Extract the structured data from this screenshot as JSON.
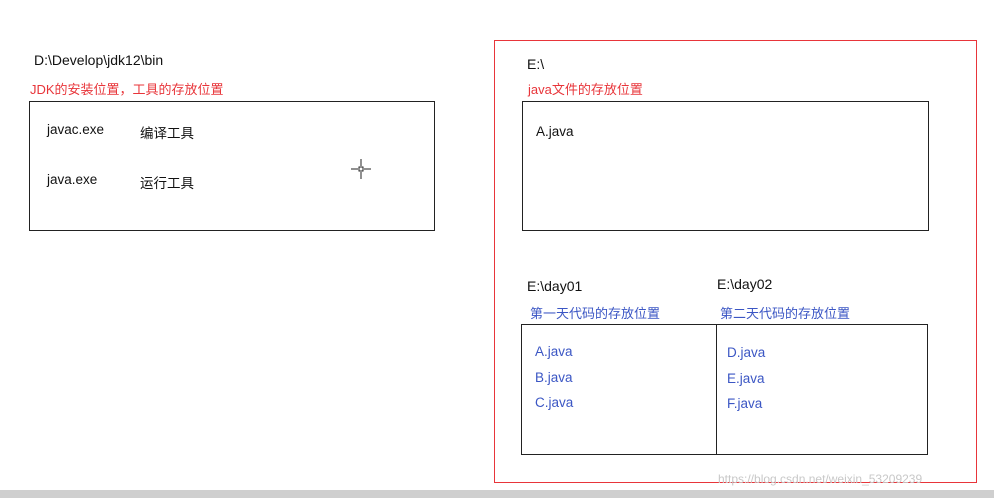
{
  "left": {
    "path": "D:\\Develop\\jdk12\\bin",
    "caption": "JDK的安装位置，工具的存放位置",
    "items": [
      {
        "file": "javac.exe",
        "desc": "编译工具"
      },
      {
        "file": "java.exe",
        "desc": "运行工具"
      }
    ]
  },
  "right": {
    "path": "E:\\",
    "caption": "java文件的存放位置",
    "file": "A.java",
    "day01": {
      "path": "E:\\day01",
      "caption": "第一天代码的存放位置",
      "files": [
        "A.java",
        "B.java",
        "C.java"
      ]
    },
    "day02": {
      "path": "E:\\day02",
      "caption": "第二天代码的存放位置",
      "files": [
        "D.java",
        "E.java",
        "F.java"
      ]
    }
  },
  "watermark": "https://blog.csdn.net/weixin_53209239",
  "colors": {
    "red": "#e8353a",
    "blue": "#3b56c4",
    "border": "#222222"
  }
}
